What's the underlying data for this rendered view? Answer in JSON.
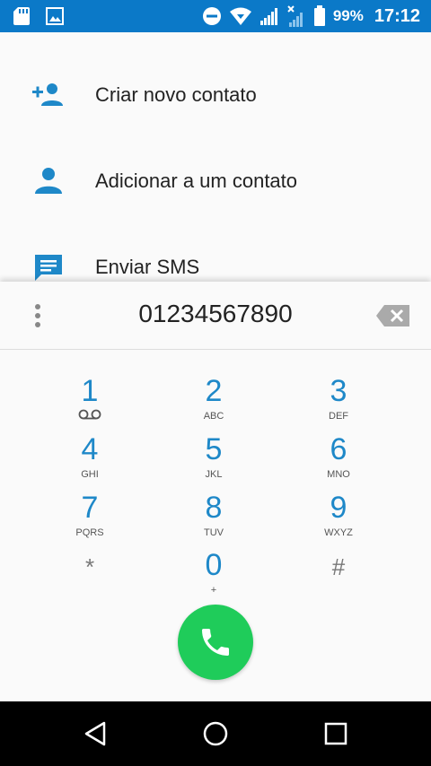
{
  "status_bar": {
    "battery": "99%",
    "time": "17:12",
    "left_icons": [
      "sd-card-icon",
      "image-icon"
    ],
    "right_icons": [
      "do-not-disturb-icon",
      "wifi-icon",
      "signal-icon",
      "signal-no-data-icon",
      "battery-icon"
    ]
  },
  "actions": [
    {
      "label": "Criar novo contato",
      "icon": "add-contact-icon"
    },
    {
      "label": "Adicionar a um contato",
      "icon": "person-icon"
    },
    {
      "label": "Enviar SMS",
      "icon": "message-icon"
    }
  ],
  "dialer": {
    "number": "01234567890",
    "keys": [
      {
        "digit": "1",
        "sub": "voicemail-icon"
      },
      {
        "digit": "2",
        "sub": "ABC"
      },
      {
        "digit": "3",
        "sub": "DEF"
      },
      {
        "digit": "4",
        "sub": "GHI"
      },
      {
        "digit": "5",
        "sub": "JKL"
      },
      {
        "digit": "6",
        "sub": "MNO"
      },
      {
        "digit": "7",
        "sub": "PQRS"
      },
      {
        "digit": "8",
        "sub": "TUV"
      },
      {
        "digit": "9",
        "sub": "WXYZ"
      },
      {
        "digit": "*",
        "sub": ""
      },
      {
        "digit": "0",
        "sub": "+"
      },
      {
        "digit": "#",
        "sub": ""
      }
    ]
  },
  "colors": {
    "status_bar": "#0b79c8",
    "accent": "#1e88c8",
    "call_button": "#1fcc5a"
  }
}
